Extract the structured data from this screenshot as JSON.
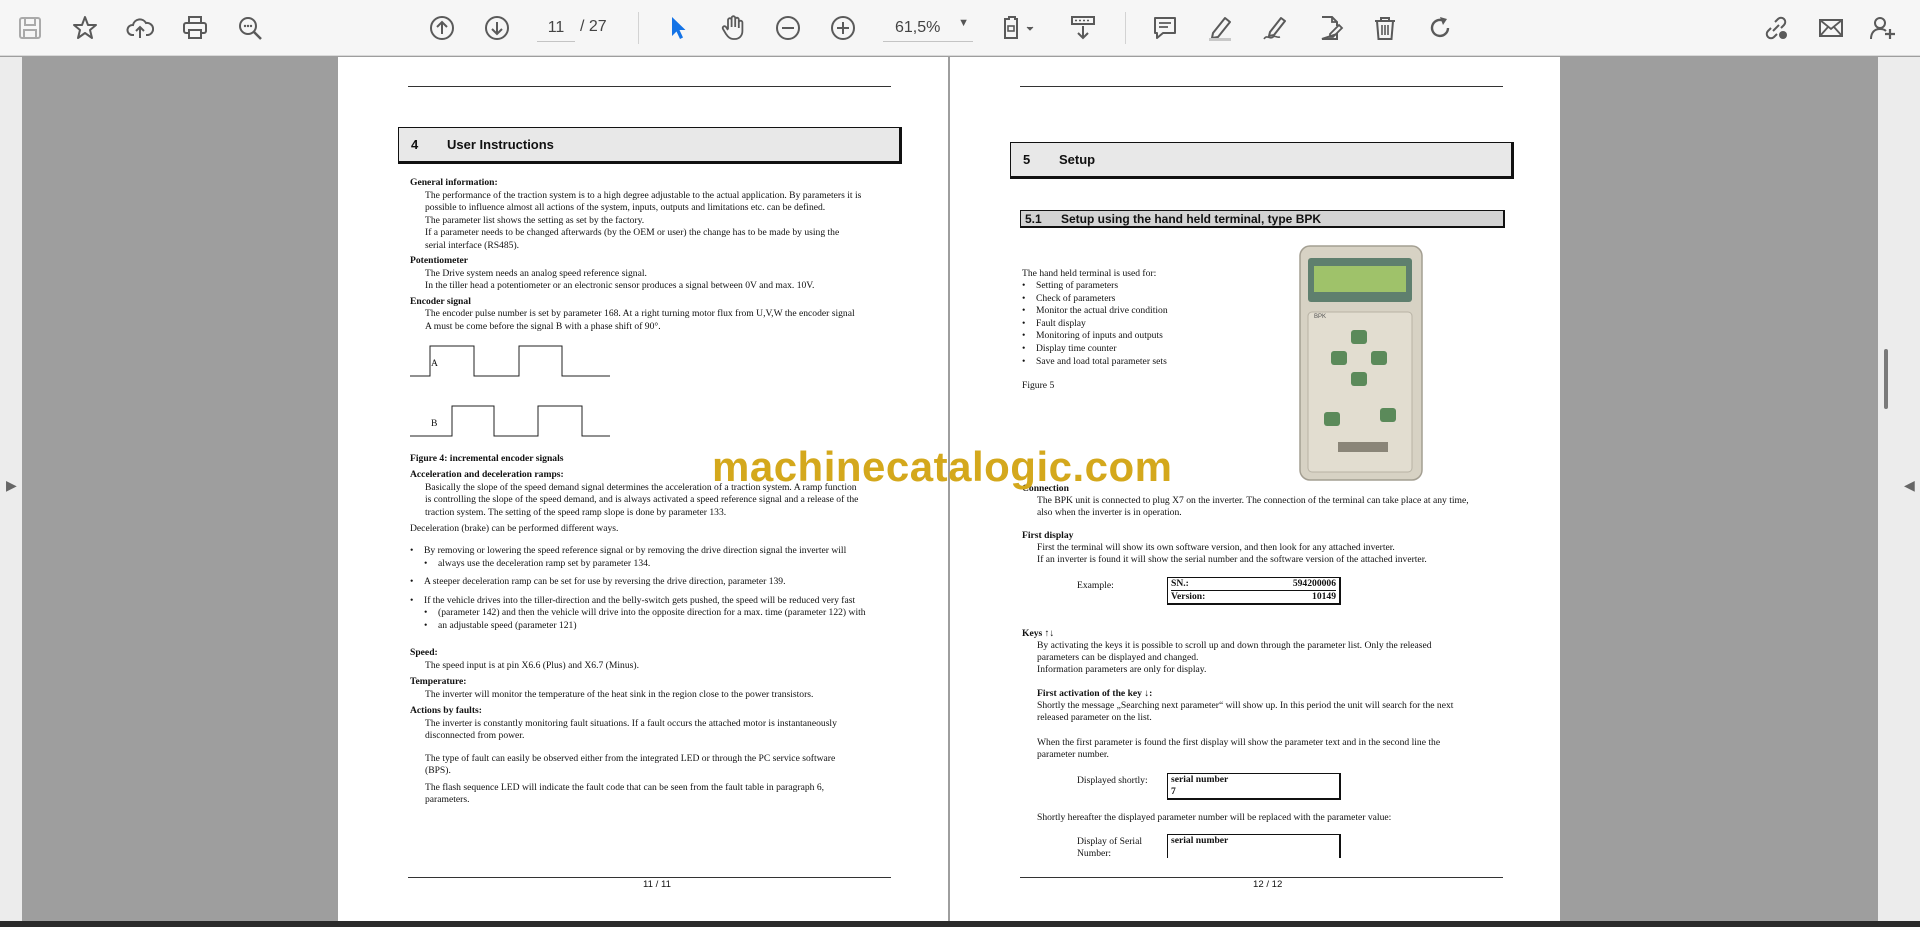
{
  "toolbar": {
    "current_page": "11",
    "page_total": "/  27",
    "zoom": "61,5%",
    "colors": {
      "accent": "#1473e6",
      "icon": "#5a5a5a"
    }
  },
  "page_left": {
    "section_num": "4",
    "section_title": "User Instructions",
    "lines": [
      {
        "text": "General information:",
        "bold": true
      },
      {
        "text": "The performance of the traction system is to a high degree adjustable to the actual application. By parameters it is",
        "indent": true
      },
      {
        "text": "possible to influence almost all actions of the system, inputs, outputs and limitations etc. can be defined.",
        "indent": true
      },
      {
        "text": "The parameter list shows the setting as set by the factory.",
        "indent": true
      },
      {
        "text": "If a parameter needs to be changed afterwards (by the OEM or user) the change has to be made by using the",
        "indent": true
      },
      {
        "text": "serial interface (RS485).",
        "indent": true
      },
      {
        "text": "Potentiometer",
        "bold": true
      },
      {
        "text": "The Drive system needs an analog speed reference signal.",
        "indent": true
      },
      {
        "text": "In the tiller head a potentiometer or an electronic sensor produces a signal between 0V and max. 10V.",
        "indent": true
      },
      {
        "text": "Encoder signal",
        "bold": true
      },
      {
        "text": "The encoder pulse number is set by parameter 168.  At a right turning motor flux from U,V,W the encoder signal",
        "indent": true
      },
      {
        "text": "A must be come before the signal B with a phase shift of 90°.",
        "indent": true
      }
    ],
    "encoder_a": "A",
    "encoder_b": "B",
    "figure_caption": "Figure 4:  incremental encoder signals",
    "lines2": [
      {
        "text": "Acceleration and deceleration ramps:",
        "bold": true
      },
      {
        "text": "Basically the slope of the speed demand signal determines the acceleration of a traction system. A ramp function",
        "indent": true
      },
      {
        "text": "is controlling the slope of the speed demand, and is always activated a speed reference signal and a release of the",
        "indent": true
      },
      {
        "text": "traction system. The setting of the speed ramp slope is done by parameter 133.",
        "indent": true
      },
      {
        "text": "Deceleration (brake) can be performed different ways."
      }
    ],
    "bullets": [
      "By removing or lowering the speed reference signal or by removing the drive direction signal the inverter will",
      "always use the deceleration ramp set by parameter 134.",
      "A steeper deceleration ramp can be set for use by reversing the drive direction, parameter 139.",
      "If the vehicle drives into the tiller-direction and the belly-switch gets pushed, the speed will be reduced very fast",
      "(parameter 142) and then the vehicle will drive into the opposite direction for a max. time (parameter 122) with",
      "an adjustable speed (parameter 121)"
    ],
    "lines3": [
      {
        "text": "Speed:",
        "bold": true
      },
      {
        "text": "The speed input is at pin X6.6 (Plus) and X6.7 (Minus).",
        "indent": true
      },
      {
        "text": "Temperature:",
        "bold": true
      },
      {
        "text": "The inverter will monitor the temperature of the heat sink in the region close to the power transistors.",
        "indent": true
      },
      {
        "text": "Actions by faults:",
        "bold": true
      },
      {
        "text": "The inverter is constantly monitoring fault situations. If a fault occurs the attached motor is instantaneously",
        "indent": true
      },
      {
        "text": "disconnected from power.",
        "indent": true
      },
      {
        "text": "The type of fault can easily be observed either from the integrated LED or through the PC service software",
        "indent": true
      },
      {
        "text": "(BPS).",
        "indent": true
      },
      {
        "text": "The flash sequence LED will indicate the fault code that can be seen from the fault table in paragraph 6,",
        "indent": true
      },
      {
        "text": "parameters.",
        "indent": true
      }
    ],
    "page_number": "11 / 11"
  },
  "page_right": {
    "section_num": "5",
    "section_title": "Setup",
    "sub_num": "5.1",
    "sub_title": "Setup using the hand held terminal, type BPK",
    "intro": "The hand held terminal is used for:",
    "uses": [
      "Setting of parameters",
      "Check of parameters",
      "Monitor the actual drive condition",
      "Fault display",
      "Monitoring of inputs and outputs",
      "Display time counter",
      "Save and load total parameter sets"
    ],
    "figure": "Figure 5",
    "device_label": "BPK",
    "connection_title": "Connection",
    "connection_1": "The BPK unit is connected to plug X7 on the inverter. The connection of the terminal can take place at any time,",
    "connection_2": "also when the inverter is in operation.",
    "first_display_title": "First display",
    "first_display_1": "First the terminal will show its own software version, and then look for any attached inverter.",
    "first_display_2": "If an inverter is found it will show the serial number and the software version of the attached inverter.",
    "example_label": "Example:",
    "sn_label": "SN.:",
    "sn_value": "594200006",
    "version_label": "Version:",
    "version_value": "10149",
    "keys_title": "Keys ↑↓",
    "keys_1": "By activating the keys it is possible to scroll up and down through the parameter list. Only the released",
    "keys_2": "parameters can be displayed and changed.",
    "keys_3": "Information parameters are only for display.",
    "first_act_title": "First activation of the key ↓:",
    "first_act_1": "Shortly the message „Searching next parameter“ will show up. In this period the unit will search for the next",
    "first_act_2": "released parameter on the list.",
    "first_param_1": "When the first parameter is found the first display will show the parameter text and in the second line the",
    "first_param_2": "parameter number.",
    "displayed_shortly": "Displayed shortly:",
    "box1_line1": "serial number",
    "box1_line2": "7",
    "hereafter": "Shortly hereafter the displayed parameter number will be replaced with the parameter value:",
    "display_serial_1": "Display of Serial",
    "display_serial_2": "Number:",
    "box2_line1": "serial number",
    "page_number": "12 / 12"
  },
  "watermark": "machinecatalogic.com"
}
